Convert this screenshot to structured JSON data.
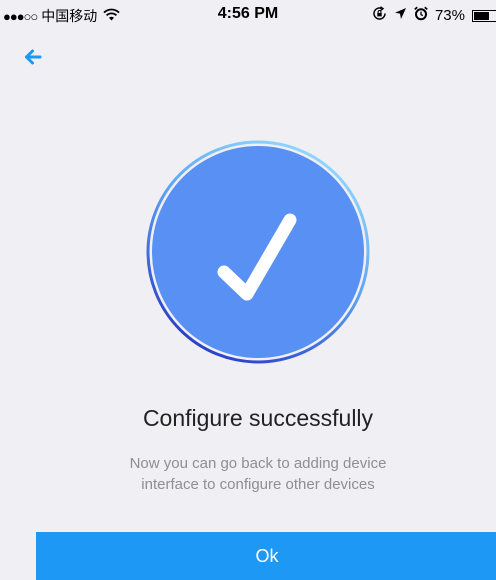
{
  "status_bar": {
    "signal": "●●●○○",
    "carrier": "中国移动",
    "time": "4:56 PM",
    "battery": "73%",
    "battery_level": 0.73,
    "icons": [
      "wifi-icon",
      "rotation-lock-icon",
      "location-icon",
      "alarm-icon",
      "battery-icon"
    ]
  },
  "nav": {
    "back_icon": "back-arrow-icon"
  },
  "success": {
    "icon": "checkmark-icon",
    "title": "Configure successfully",
    "description_line1": "Now you can go back to adding device",
    "description_line2": "interface to configure other devices"
  },
  "actions": {
    "ok_label": "Ok"
  },
  "colors": {
    "background": "#efeff4",
    "accent": "#1e98f5",
    "circle": "#5890f3",
    "circle_ring_dark": "#2a3fc9",
    "circle_ring_light": "#8fd6ff",
    "title": "#222222",
    "description": "#8e8e93"
  }
}
